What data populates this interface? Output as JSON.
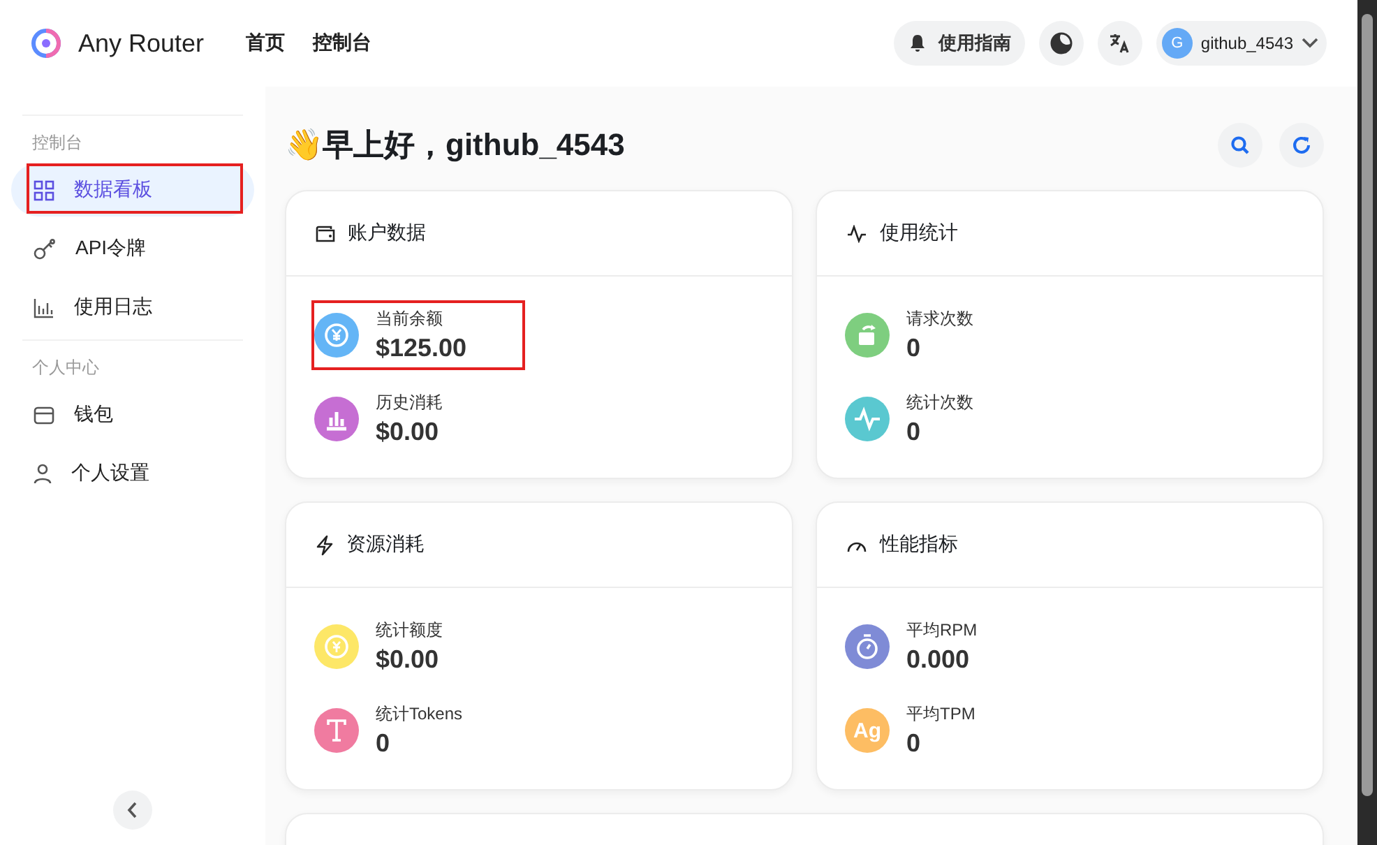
{
  "header": {
    "brand": "Any Router",
    "nav": [
      {
        "label": "首页"
      },
      {
        "label": "控制台"
      }
    ],
    "guide_button": "使用指南",
    "user": {
      "avatar_letter": "G",
      "name": "github_4543"
    }
  },
  "sidebar": {
    "sections": [
      {
        "title": "控制台",
        "items": [
          {
            "label": "数据看板",
            "selected": true,
            "highlighted": true
          },
          {
            "label": "API令牌",
            "selected": false,
            "highlighted": false
          },
          {
            "label": "使用日志",
            "selected": false,
            "highlighted": false
          }
        ]
      },
      {
        "title": "个人中心",
        "items": [
          {
            "label": "钱包",
            "selected": false,
            "highlighted": false
          },
          {
            "label": "个人设置",
            "selected": false,
            "highlighted": false
          }
        ]
      }
    ]
  },
  "greeting": {
    "emoji": "👋",
    "text": "早上好，github_4543"
  },
  "cards": [
    {
      "title": "账户数据",
      "stats": [
        {
          "label": "当前余额",
          "value": "$125.00",
          "color": "#64b5f6",
          "highlighted": true
        },
        {
          "label": "历史消耗",
          "value": "$0.00",
          "color": "#c66ed3",
          "highlighted": false
        }
      ]
    },
    {
      "title": "使用统计",
      "stats": [
        {
          "label": "请求次数",
          "value": "0",
          "color": "#7ece7f",
          "highlighted": false
        },
        {
          "label": "统计次数",
          "value": "0",
          "color": "#5ac8d0",
          "highlighted": false
        }
      ]
    },
    {
      "title": "资源消耗",
      "stats": [
        {
          "label": "统计额度",
          "value": "$0.00",
          "color": "#fde767",
          "highlighted": false
        },
        {
          "label": "统计Tokens",
          "value": "0",
          "color": "#f07ba0",
          "highlighted": false
        }
      ]
    },
    {
      "title": "性能指标",
      "stats": [
        {
          "label": "平均RPM",
          "value": "0.000",
          "color": "#7f8bd6",
          "highlighted": false
        },
        {
          "label": "平均TPM",
          "value": "0",
          "color": "#fdbd63",
          "highlighted": false,
          "icon_text": "Ag"
        }
      ]
    }
  ]
}
